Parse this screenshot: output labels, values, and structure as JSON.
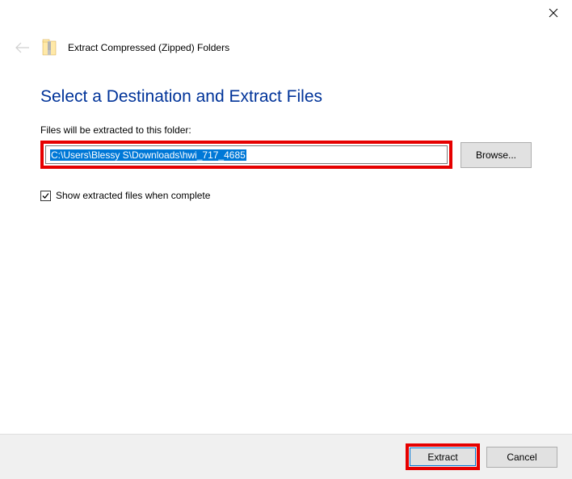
{
  "titlebar": {
    "close": "Close"
  },
  "header": {
    "title": "Extract Compressed (Zipped) Folders"
  },
  "main": {
    "heading": "Select a Destination and Extract Files",
    "field_label": "Files will be extracted to this folder:",
    "path_value": "C:\\Users\\Blessy S\\Downloads\\hwi_717_4685",
    "browse_label": "Browse...",
    "checkbox_label": "Show extracted files when complete",
    "checkbox_checked": true
  },
  "footer": {
    "extract_label": "Extract",
    "cancel_label": "Cancel"
  }
}
